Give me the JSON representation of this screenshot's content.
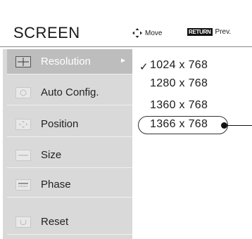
{
  "header": {
    "title": "SCREEN",
    "move_label": "Move",
    "return_key": "RETURN",
    "return_label": "Prev."
  },
  "menu": {
    "items": [
      {
        "label": "Resolution",
        "icon": "crosshair-icon",
        "active": true
      },
      {
        "label": "Auto Config.",
        "icon": "auto-config-icon",
        "active": false
      },
      {
        "label": "Position",
        "icon": "position-icon",
        "active": false
      },
      {
        "label": "Size",
        "icon": "size-icon",
        "active": false
      },
      {
        "label": "Phase",
        "icon": "phase-icon",
        "active": false
      },
      {
        "label": "Reset",
        "icon": "reset-icon",
        "active": false
      }
    ]
  },
  "resolution_options": {
    "checked_mark": "✓",
    "items": [
      "1024 x 768",
      "1280 x 768",
      "1360 x 768",
      "1366 x 768"
    ],
    "checked_value": "1024 x 768",
    "highlighted_value": "1366 x 768"
  },
  "colors": {
    "menu_bg": "#d9d9d9",
    "active_bg": "#bdbdbd",
    "text": "#1a1a1a"
  }
}
